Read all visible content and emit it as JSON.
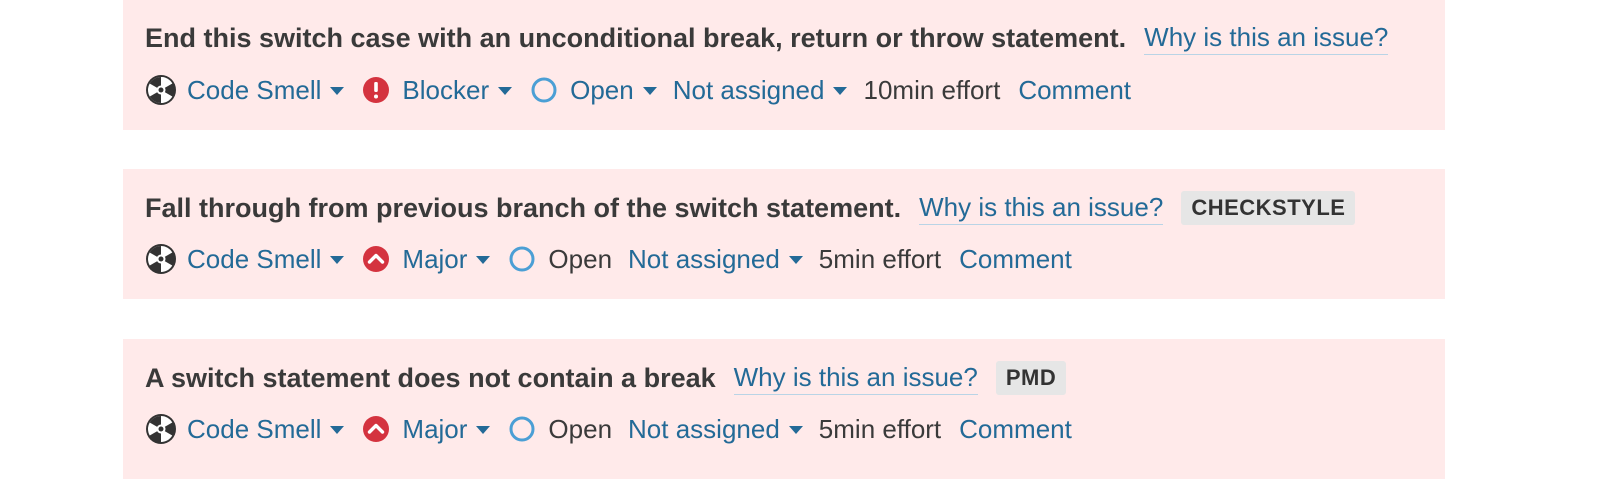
{
  "issues": [
    {
      "message": "End this switch case with an unconditional break, return or throw statement.",
      "why_link": "Why is this an issue?",
      "tag": "",
      "type": {
        "label": "Code Smell",
        "icon": "code-smell-icon"
      },
      "severity": {
        "label": "Blocker",
        "icon": "blocker-icon",
        "color": "#d4333f"
      },
      "status": {
        "label": "Open",
        "icon": "open-status-icon",
        "has_dropdown": true
      },
      "assignee": "Not assigned",
      "effort": "10min effort",
      "comment": "Comment"
    },
    {
      "message": "Fall through from previous branch of the switch statement.",
      "why_link": "Why is this an issue?",
      "tag": "CHECKSTYLE",
      "type": {
        "label": "Code Smell",
        "icon": "code-smell-icon"
      },
      "severity": {
        "label": "Major",
        "icon": "major-icon",
        "color": "#d4333f"
      },
      "status": {
        "label": "Open",
        "icon": "open-status-icon",
        "has_dropdown": false
      },
      "assignee": "Not assigned",
      "effort": "5min effort",
      "comment": "Comment"
    },
    {
      "message": "A switch statement does not contain a break",
      "why_link": "Why is this an issue?",
      "tag": "PMD",
      "type": {
        "label": "Code Smell",
        "icon": "code-smell-icon"
      },
      "severity": {
        "label": "Major",
        "icon": "major-icon",
        "color": "#d4333f"
      },
      "status": {
        "label": "Open",
        "icon": "open-status-icon",
        "has_dropdown": false
      },
      "assignee": "Not assigned",
      "effort": "5min effort",
      "comment": "Comment"
    }
  ],
  "colors": {
    "issue_background": "#ffeaea",
    "link": "#236a97",
    "text": "#3a3a3a",
    "severity": "#d4333f",
    "status_ring": "#4b9fd5",
    "tag_background": "#e6e6e6"
  }
}
